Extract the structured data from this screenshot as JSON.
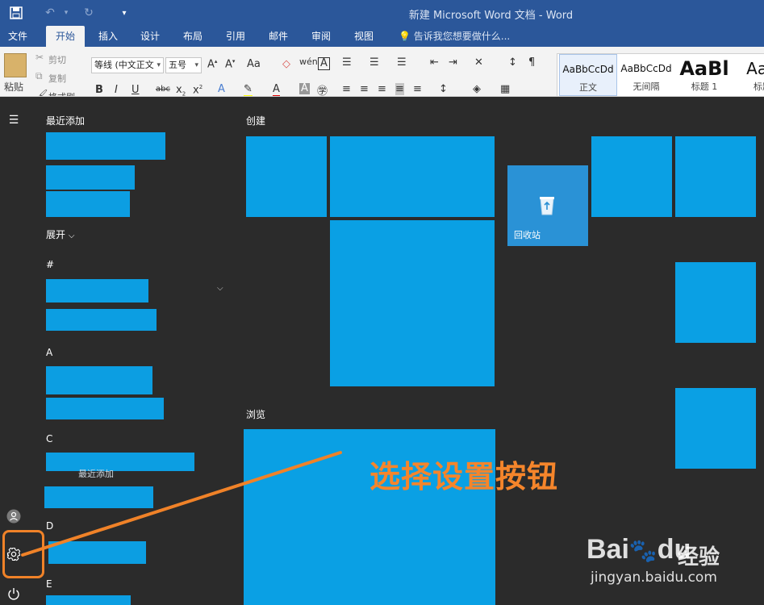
{
  "word": {
    "title": "新建 Microsoft Word 文档 - Word",
    "tabs": [
      "文件",
      "开始",
      "插入",
      "设计",
      "布局",
      "引用",
      "邮件",
      "审阅",
      "视图"
    ],
    "active_tab": "开始",
    "tell_me": "告诉我您想要做什么...",
    "clipboard": {
      "paste": "粘贴",
      "cut": "剪切",
      "copy": "复制",
      "format_painter": "格式刷"
    },
    "font_name": "等线 (中文正文",
    "font_size": "五号",
    "styles": [
      {
        "preview": "AaBbCcDd",
        "name": "正文"
      },
      {
        "preview": "AaBbCcDd",
        "name": "无间隔"
      },
      {
        "preview": "AaBl",
        "name": "标题 1"
      },
      {
        "preview": "AaB",
        "name": "标题"
      }
    ]
  },
  "start_menu": {
    "recent_header": "最近添加",
    "expand_label": "展开",
    "create_header": "创建",
    "browse_header": "浏览",
    "letters": [
      "#",
      "A",
      "C",
      "D",
      "E"
    ],
    "faint_label": "最近添加",
    "recycle_bin": "回收站",
    "accent_color": "#0aa0e4"
  },
  "annotation": {
    "callout": "选择设置按钮",
    "color": "#f08228"
  },
  "watermark": {
    "logo": "Bai",
    "logo_suffix": "du",
    "text": "经验",
    "url": "jingyan.baidu.com"
  }
}
